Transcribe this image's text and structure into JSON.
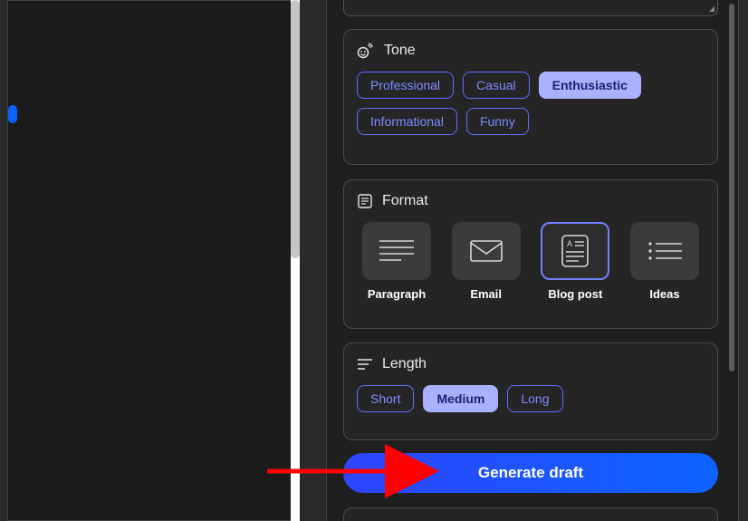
{
  "tone": {
    "title": "Tone",
    "options": {
      "professional": "Professional",
      "casual": "Casual",
      "enthusiastic": "Enthusiastic",
      "informational": "Informational",
      "funny": "Funny"
    },
    "selected": "enthusiastic"
  },
  "format": {
    "title": "Format",
    "options": {
      "paragraph": "Paragraph",
      "email": "Email",
      "blogpost": "Blog post",
      "ideas": "Ideas"
    },
    "selected": "blogpost"
  },
  "length": {
    "title": "Length",
    "options": {
      "short": "Short",
      "medium": "Medium",
      "long": "Long"
    },
    "selected": "medium"
  },
  "generate_label": "Generate draft"
}
